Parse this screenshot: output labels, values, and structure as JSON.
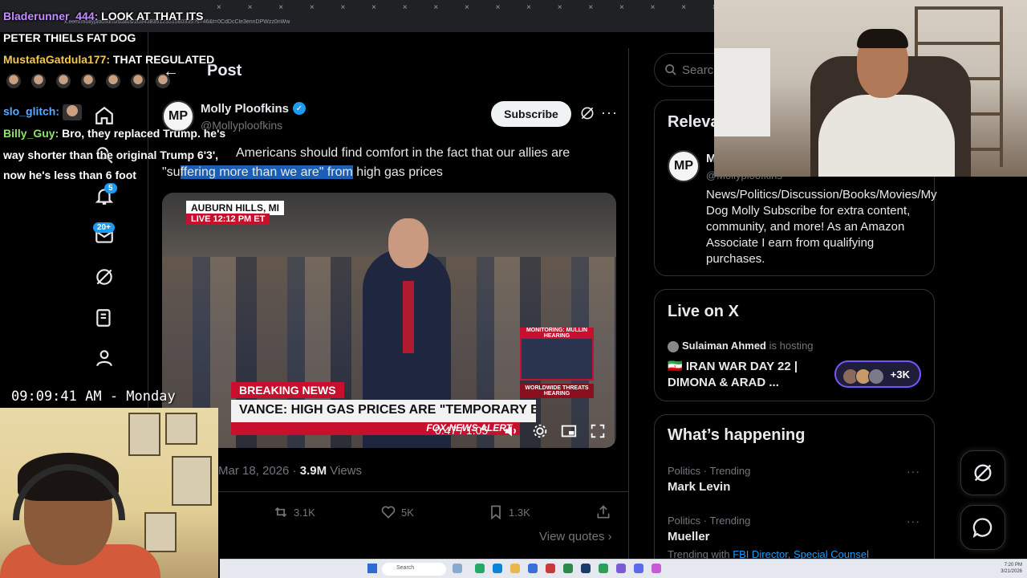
{
  "browser": {
    "tab_closers": "× × × × × × × × × × × × × × × × × × × × × × × × × × × × × × × × × × × × × × ×",
    "url": "x.com/mollyploofkins/status/2034383912351580335?s=46&t=0CdDcCle3ennDPWzz0nWw"
  },
  "nav": {
    "notifications_badge": "5",
    "messages_badge": "20+"
  },
  "post": {
    "header_title": "Post",
    "author_name": "Molly Ploofkins",
    "author_handle": "@Mollyploofkins",
    "subscribe_label": "Subscribe",
    "text_part1": "Americans should find comfort in the fact that our allies are",
    "text_part2a": "\"su",
    "text_part2_highlight": "ffering more than we are\" from",
    "text_part2b": " high gas prices",
    "video": {
      "location": "AUBURN HILLS, MI",
      "live_label": "LIVE",
      "live_time": "12:12 PM ET",
      "monitoring_label": "MONITORING: MULLIN HEARING",
      "worldwide_label": "WORLDWIDE THREATS HEARING",
      "breaking_label": "BREAKING NEWS",
      "headline": "VANCE: HIGH GAS PRICES ARE \"TEMPORARY BLIP\"",
      "ticker": "FOX NEWS ALERT",
      "time": "0:47 / 1:05"
    },
    "date": "Mar 18, 2026 ·",
    "views_count": "3.9M",
    "views_label": "Views",
    "reposts": "3.1K",
    "likes": "5K",
    "bookmarks": "1.3K",
    "view_quotes": "View quotes ›"
  },
  "sidebar": {
    "search_placeholder": "Search",
    "relevant_title": "Relevant people",
    "relevant_name": "M",
    "relevant_handle": "@Mollyploofkins",
    "relevant_bio": "News/Politics/Discussion/Books/Movies/My Dog Molly Subscribe for extra content, community, and more! As an Amazon Associate I earn from qualifying purchases.",
    "live_title": "Live on X",
    "live_host_name": "Sulaiman Ahmed",
    "live_host_suffix": "is hosting",
    "live_space_title": "🇮🇷 IRAN WAR DAY 22 | DIMONA & ARAD ...",
    "live_listeners": "+3K",
    "happening_title": "What’s happening",
    "trends": [
      {
        "meta": "Politics · Trending",
        "name": "Mark Levin"
      },
      {
        "meta": "Politics · Trending",
        "name": "Mueller"
      }
    ],
    "trending_with_label": "Trending with",
    "trending_with_links": "FBI Director, Special Counsel",
    "more_glyph": "···"
  },
  "chat": [
    {
      "user": "Bladerunner_444:",
      "user_color": "#c58cff",
      "msg": " LOOK AT THAT ITS"
    },
    {
      "user": "",
      "user_color": "#ffffff",
      "msg": "PETER THIELS FAT DOG"
    },
    {
      "user": "MustafaGatdula177:",
      "user_color": "#f2c94c",
      "msg": " THAT REGULATED"
    },
    {
      "user": "slo_glitch:",
      "user_color": "#5aa9ff",
      "msg": ""
    },
    {
      "user": "Billy_Guy:",
      "user_color": "#8fe36a",
      "msg": " Bro, they replaced Trump. he's"
    },
    {
      "user": "",
      "user_color": "#ffffff",
      "msg": "way shorter than the original Trump 6'3',"
    },
    {
      "user": "",
      "user_color": "#ffffff",
      "msg": "now he's less than 6 foot"
    }
  ],
  "clock": "09:09:41 AM - Monday",
  "taskbar": {
    "search": "Search",
    "time": "7:20 PM",
    "date": "3/21/2026"
  },
  "colors": {
    "accent": "#1d9bf0",
    "highlight": "#1a5fb4",
    "live_purple": "#7856ff",
    "breaking_red": "#c8102e"
  }
}
